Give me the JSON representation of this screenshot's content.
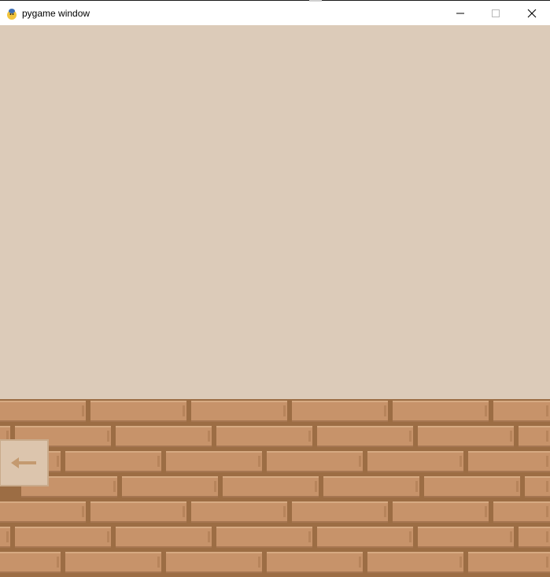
{
  "window": {
    "title": "pygame window",
    "app_icon": "pygame-snake-icon",
    "controls": {
      "minimize_icon": "minimize-icon",
      "maximize_icon": "maximize-icon",
      "close_icon": "close-icon"
    }
  },
  "game": {
    "background_color": "#dccbb9",
    "floor": {
      "style": "brick-wall",
      "brick_color": "#c7936a",
      "mortar_color": "#9c6d44"
    },
    "back_button": {
      "icon": "arrow-left-icon"
    }
  }
}
